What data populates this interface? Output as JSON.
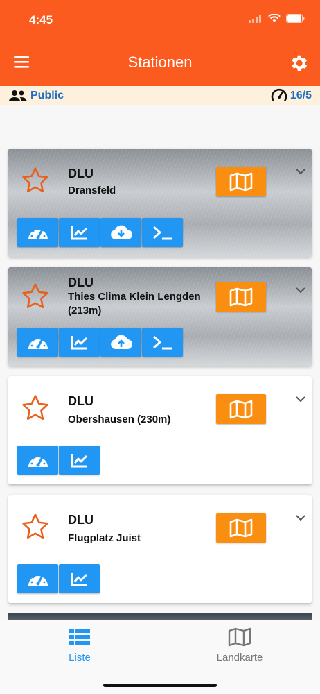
{
  "status_bar": {
    "time": "4:45"
  },
  "header": {
    "title": "Stationen"
  },
  "info_bar": {
    "mode_label": "Public",
    "count": "16/5"
  },
  "stations": [
    {
      "title": "DLU",
      "name": "Dransfeld",
      "background": "rain"
    },
    {
      "title": "DLU",
      "name": "Thies Clima Klein Lengden (213m)",
      "background": "rain"
    },
    {
      "title": "DLU",
      "name": "Obershausen (230m)",
      "background": "white"
    },
    {
      "title": "DLU",
      "name": "Flugplatz Juist",
      "background": "white"
    }
  ],
  "tabs": [
    {
      "label": "Liste",
      "active": true
    },
    {
      "label": "Landkarte",
      "active": false
    }
  ],
  "colors": {
    "header": "#fb5b1f",
    "accent_blue": "#2196f3",
    "map_button": "#f98e10",
    "star": "#e8601c",
    "info_bar": "#fdf0dc"
  }
}
